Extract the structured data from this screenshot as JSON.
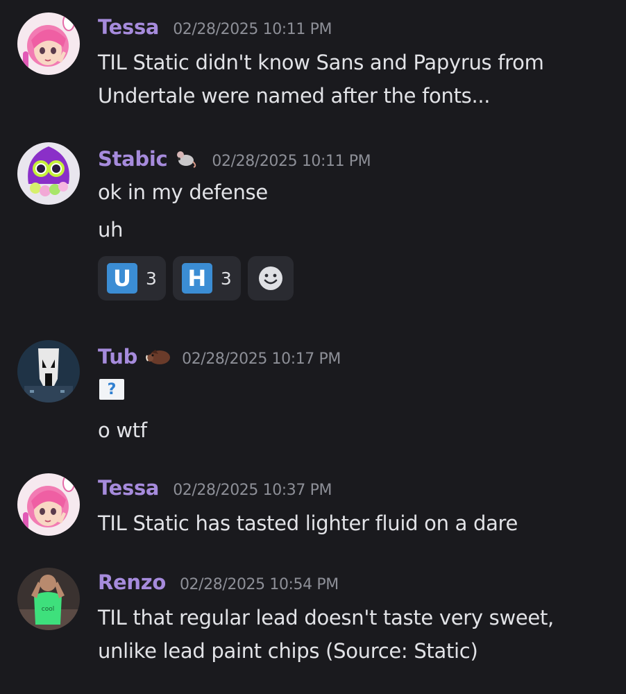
{
  "messages": [
    {
      "username": "Tessa",
      "timestamp": "02/28/2025 10:11 PM",
      "avatar": "anime-girl-avatar",
      "lines": [
        "TIL Static didn't know Sans and Papyrus from",
        "Undertale were named after the fonts..."
      ]
    },
    {
      "username": "Stabic",
      "user_emoji": "rat-icon",
      "timestamp": "02/28/2025 10:11 PM",
      "avatar": "squid-avatar",
      "lines": [
        "ok in my defense",
        "uh"
      ],
      "reactions": [
        {
          "emoji": "U",
          "count": "3"
        },
        {
          "emoji": "H",
          "count": "3"
        }
      ],
      "add_reaction_icon": "add-reaction-icon"
    },
    {
      "username": "Tub",
      "user_emoji": "boar-icon",
      "timestamp": "02/28/2025 10:17 PM",
      "avatar": "skull-avatar",
      "flag_emoji": "?",
      "lines": [
        "o wtf"
      ]
    },
    {
      "username": "Tessa",
      "timestamp": "02/28/2025 10:37 PM",
      "avatar": "anime-girl-avatar",
      "lines": [
        "TIL Static has tasted lighter fluid on a dare"
      ]
    },
    {
      "username": "Renzo",
      "timestamp": "02/28/2025 10:54 PM",
      "avatar": "photo-avatar",
      "lines": [
        "TIL that regular lead doesn't taste very sweet,",
        "unlike lead paint chips (Source: Static)"
      ]
    }
  ],
  "colors": {
    "background": "#1a1a1e",
    "username": "#a68bdc",
    "timestamp": "#8d8f97",
    "text": "#e2e3e7",
    "reaction_bg": "#2a2b31",
    "letter_emoji": "#3b8dd4"
  }
}
